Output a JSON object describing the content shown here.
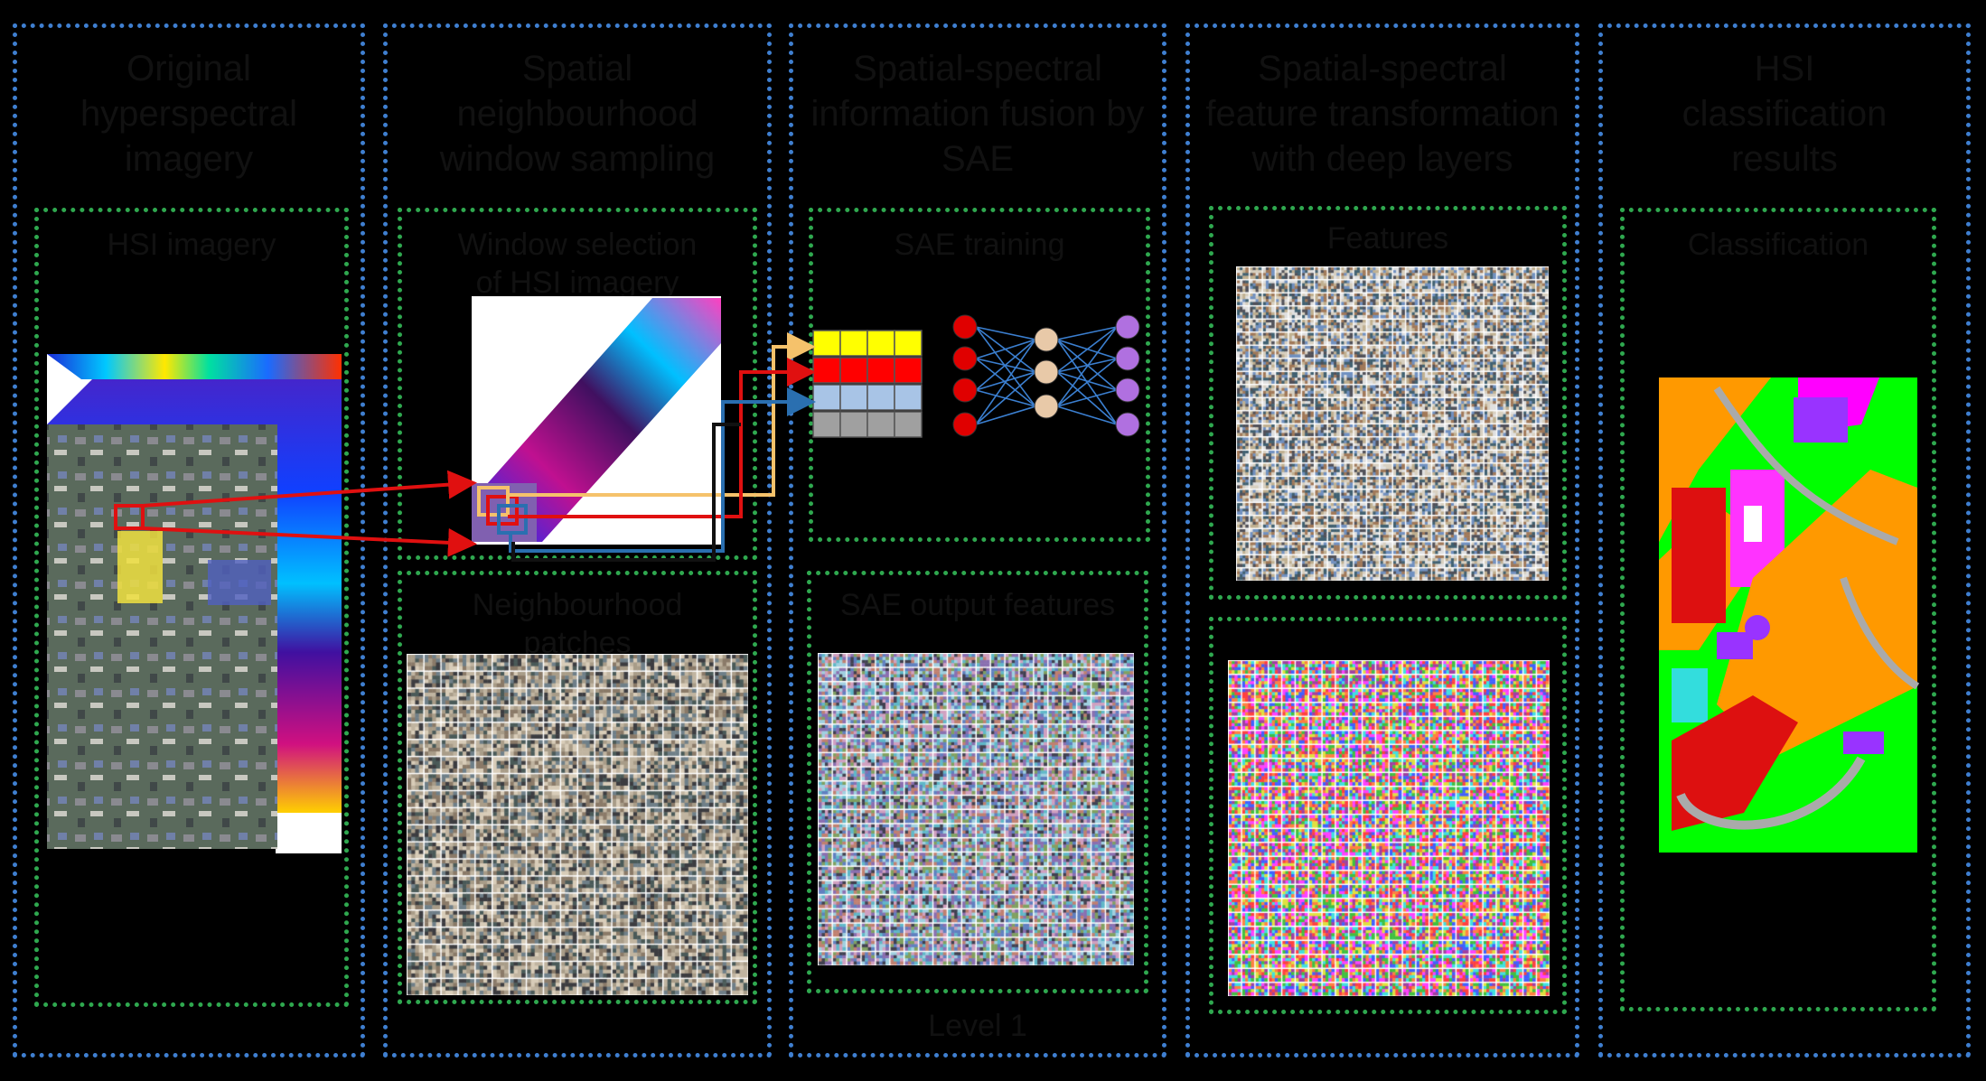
{
  "colors": {
    "blue_border": "#3f7fd0",
    "green_border": "#2fa84f",
    "arrow_red": "#e01010",
    "arrow_yellow": "#f5c26b",
    "arrow_blue": "#2a6fb0",
    "arrow_black": "#111111",
    "feature_yellow": "#ffff00",
    "feature_red": "#ff0000",
    "feature_lightblue": "#a8c4e6",
    "feature_gray": "#a0a0a0",
    "node_red": "#e00000",
    "node_beige": "#e8c9a8",
    "node_purple": "#b070e0",
    "map_green": "#00ff00",
    "map_orange": "#ff9900",
    "map_magenta": "#ff00ff",
    "map_purple": "#9933ff",
    "map_cyan": "#33dddd"
  },
  "stages": [
    {
      "title": "Original\nhyperspectral\nimagery",
      "sub": "HSI imagery"
    },
    {
      "title": "Spatial\nneighbourhood\nwindow sampling",
      "sub": "Window selection\nof HSI imagery",
      "sub2": "Neighbourhood\npatches"
    },
    {
      "title": "Spatial-spectral\ninformation fusion by\nSAE",
      "sub": "SAE training",
      "sub2": "SAE output features",
      "footer": "Level 1"
    },
    {
      "title": "Spatial-spectral\nfeature transformation\nwith deep layers",
      "sub": "Features",
      "sub2": ""
    },
    {
      "title": "HSI\nclassification\nresults",
      "sub": "Classification"
    }
  ]
}
